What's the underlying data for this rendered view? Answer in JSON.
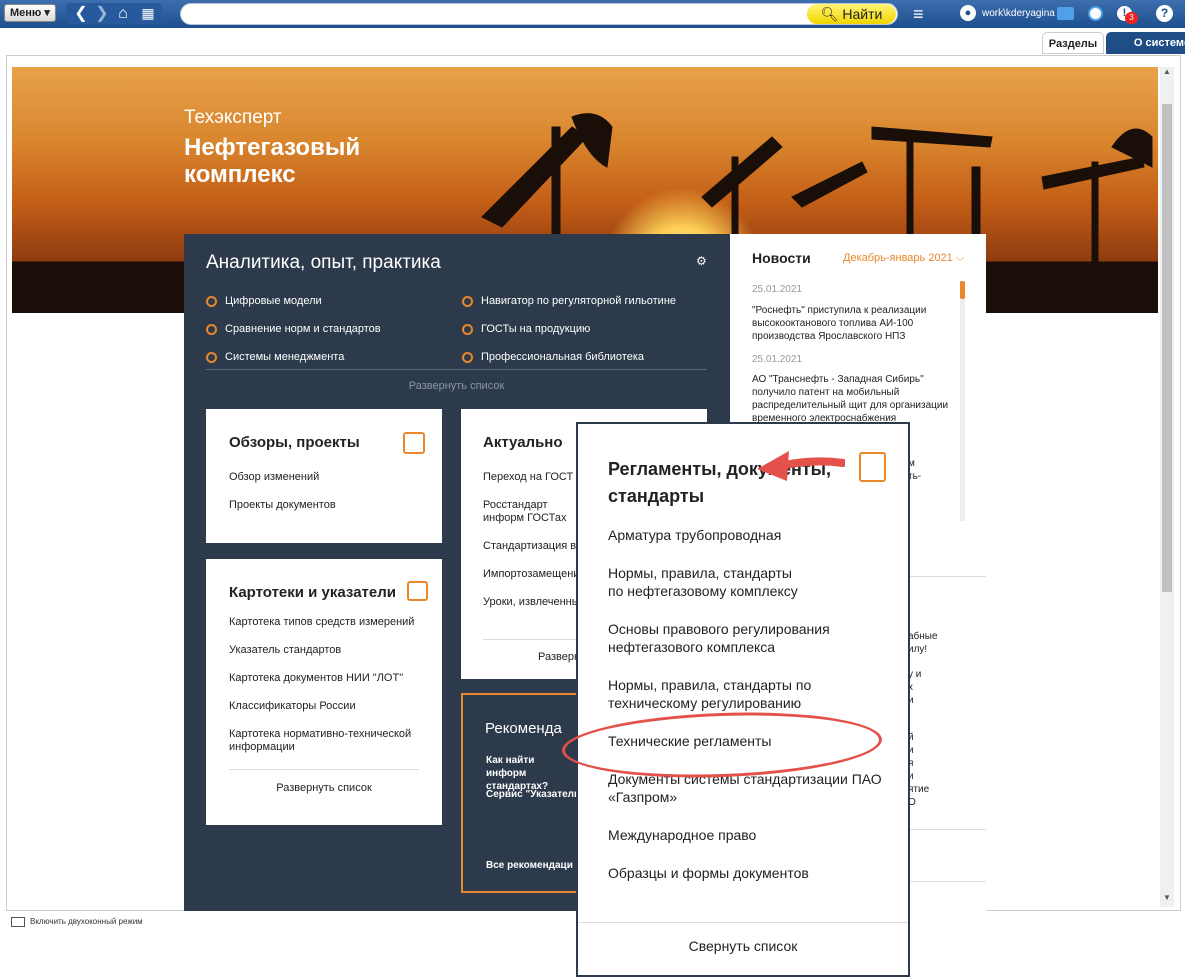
{
  "toolbar": {
    "menu_label": "Меню ▾",
    "find_label": "Найти",
    "search_placeholder": "",
    "user": "work\\kderyagina",
    "notification_count": "3"
  },
  "tabs": [
    {
      "label": "Разделы"
    },
    {
      "label": "О системе"
    }
  ],
  "hero": {
    "brand": "Техэксперт",
    "title": "Нефтегазовый комплекс"
  },
  "analytics": {
    "title": "Аналитика, опыт, практика",
    "items_left": [
      "Цифровые модели",
      "Сравнение норм и стандартов",
      "Системы менеджмента"
    ],
    "items_right": [
      "Навигатор по регуляторной гильотине",
      "ГОСТы на продукцию",
      "Профессиональная библиотека"
    ],
    "expand": "Развернуть список"
  },
  "reviews": {
    "title": "Обзоры, проекты",
    "items": [
      "Обзор изменений",
      "Проекты документов"
    ]
  },
  "cards_index": {
    "title": "Картотеки и указатели",
    "items": [
      "Картотека типов средств измерений",
      "Указатель стандартов",
      "Картотека документов НИИ \"ЛОТ\"",
      "Классификаторы России",
      "Картотека нормативно-технической информации"
    ],
    "expand": "Развернуть список"
  },
  "actual": {
    "title": "Актуально",
    "items": [
      "Переход на ГОСТ Р",
      "Росстандарт информ ГОСТах",
      "Стандартизация в",
      "Импортозамещени",
      "Уроки, извлеченны"
    ],
    "expand": "Разверн"
  },
  "recommend": {
    "title": "Рекоменда",
    "items": [
      "Как найти информ стандартах?",
      "Сервис \"Указатель",
      "Все рекомендаци"
    ]
  },
  "news": {
    "title": "Новости",
    "period": "Декабрь-январь 2021",
    "entries": [
      {
        "date": "25.01.2021",
        "text": "\"Роснефть\" приступила к реализации высокооктанового топлива АИ-100 производства Ярославского НПЗ"
      },
      {
        "date": "25.01.2021",
        "text": "АО \"Транснефть - Западная Сибирь\" получило патент на мобильный распределительный щит для организации временного электроснабжения"
      }
    ],
    "fragments": [
      "м",
      "ть-",
      "абные",
      "илу!",
      "у и",
      "х",
      "и",
      "й",
      "и",
      "я",
      "и",
      "ятие",
      "О"
    ]
  },
  "popup": {
    "title": "Регламенты, документы, стандарты",
    "items": [
      "Арматура трубопроводная",
      "Нормы, правила, стандарты по нефтегазовому комплексу",
      "Основы правового регулирования нефтегазового комплекса",
      "Нормы, правила, стандарты по техническому регулированию",
      "Технические регламенты",
      "Документы системы стандартизации ПАО «Газпром»",
      "Международное право",
      "Образцы и формы документов"
    ],
    "collapse": "Свернуть список"
  },
  "statusbar": {
    "text": "Включить двухоконный режим"
  },
  "colors": {
    "accent": "#e8882a",
    "panel": "#2c3a4b",
    "topbar": "#1d4f8f",
    "highlight": "#e4514a"
  }
}
